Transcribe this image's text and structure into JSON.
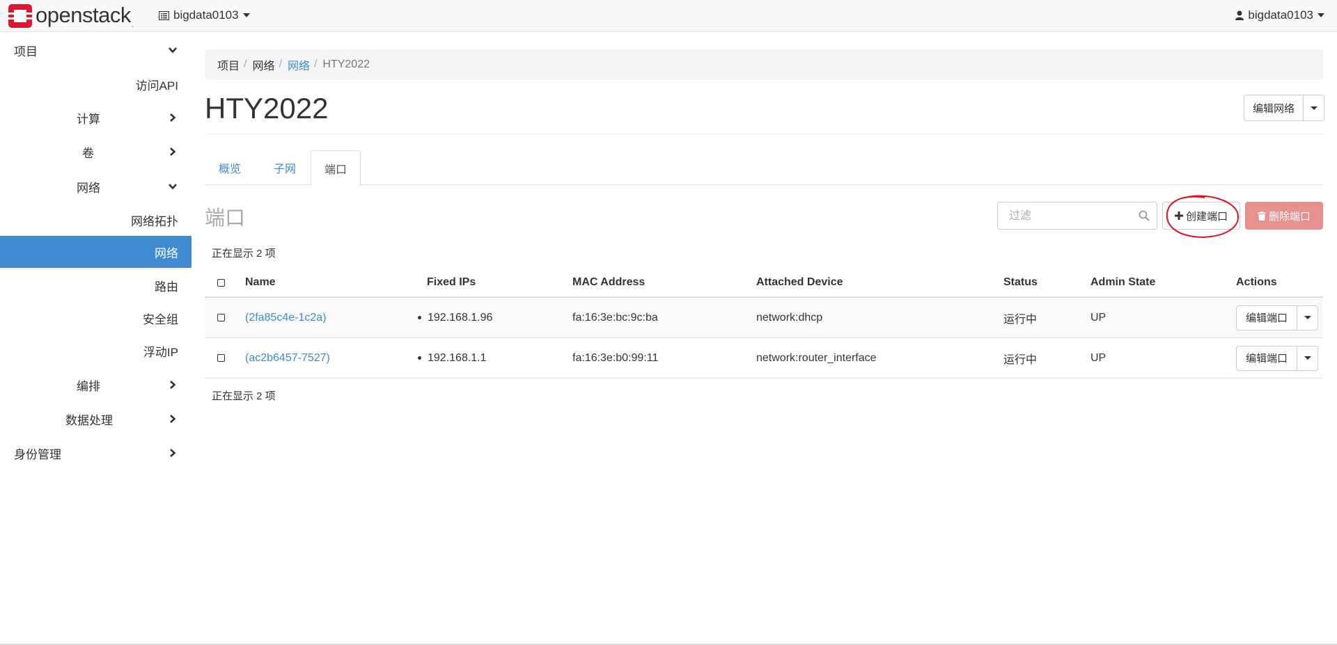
{
  "brand": {
    "name": "openstack",
    "reg": "."
  },
  "navbar": {
    "project": "bigdata0103",
    "user": "bigdata0103"
  },
  "sidebar": {
    "items": [
      {
        "label": "项目"
      },
      {
        "label": "访问API"
      },
      {
        "label": "计算"
      },
      {
        "label": "卷"
      },
      {
        "label": "网络"
      },
      {
        "label": "网络拓扑"
      },
      {
        "label": "网络"
      },
      {
        "label": "路由"
      },
      {
        "label": "安全组"
      },
      {
        "label": "浮动IP"
      },
      {
        "label": "编排"
      },
      {
        "label": "数据处理"
      },
      {
        "label": "身份管理"
      }
    ]
  },
  "breadcrumb": [
    "项目",
    "网络",
    "网络",
    "HTY2022"
  ],
  "page": {
    "title": "HTY2022",
    "edit_network": "编辑网络"
  },
  "tabs": [
    "概览",
    "子网",
    "端口"
  ],
  "ports": {
    "section_title": "端口",
    "filter_placeholder": "过滤",
    "create_label": "创建端口",
    "delete_label": "删除端口",
    "count_text": "正在显示 2 项",
    "columns": [
      "Name",
      "Fixed IPs",
      "MAC Address",
      "Attached Device",
      "Status",
      "Admin State",
      "Actions"
    ],
    "rows": [
      {
        "name": "(2fa85c4e-1c2a)",
        "ip": "192.168.1.96",
        "mac": "fa:16:3e:bc:9c:ba",
        "device": "network:dhcp",
        "status": "运行中",
        "admin": "UP",
        "action": "编辑端口"
      },
      {
        "name": "(ac2b6457-7527)",
        "ip": "192.168.1.1",
        "mac": "fa:16:3e:b0:99:11",
        "device": "network:router_interface",
        "status": "运行中",
        "admin": "UP",
        "action": "编辑端口"
      }
    ]
  },
  "colors": {
    "accent": "#3f8ad0",
    "danger": "#e7908e",
    "logo": "#da1a32",
    "annotation": "#e0101e"
  }
}
